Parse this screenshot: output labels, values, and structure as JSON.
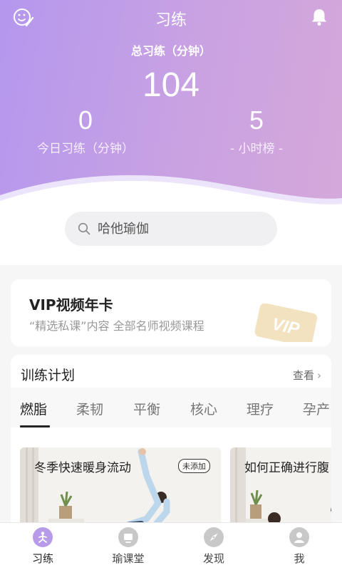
{
  "header": {
    "title": "习练",
    "total_label": "总习练（分钟）",
    "total_value": "104",
    "today_value": "0",
    "today_label": "今日习练（分钟）",
    "rank_value": "5",
    "rank_label": "- 小时榜 -",
    "left_icon": "smile-pen-icon",
    "right_icon": "bell-icon",
    "gradient_start": "#b497ee",
    "gradient_end": "#d5a8da"
  },
  "search": {
    "placeholder": "哈他瑜伽"
  },
  "vip": {
    "title": "VIP视频年卡",
    "subtitle": "“精选私课”内容 全部名师视频课程",
    "badge_text": "VIP",
    "badge_color": "#f3e2bf"
  },
  "plan": {
    "title": "训练计划",
    "more": "查看",
    "tabs": [
      {
        "label": "燃脂",
        "active": true
      },
      {
        "label": "柔韧",
        "active": false
      },
      {
        "label": "平衡",
        "active": false
      },
      {
        "label": "核心",
        "active": false
      },
      {
        "label": "理疗",
        "active": false
      },
      {
        "label": "孕产",
        "active": false
      }
    ],
    "lessons": [
      {
        "title": "冬季快速暖身流动",
        "tag": "未添加"
      },
      {
        "title": "如何正确进行腹"
      }
    ]
  },
  "tabbar": {
    "items": [
      {
        "label": "习练",
        "icon": "yoga-icon",
        "active": true
      },
      {
        "label": "瑜课堂",
        "icon": "classroom-icon",
        "active": false
      },
      {
        "label": "发现",
        "icon": "compass-icon",
        "active": false
      },
      {
        "label": "我",
        "icon": "profile-icon",
        "active": false
      }
    ],
    "active_color": "#b79be8",
    "inactive_color": "#c8c8c8"
  }
}
